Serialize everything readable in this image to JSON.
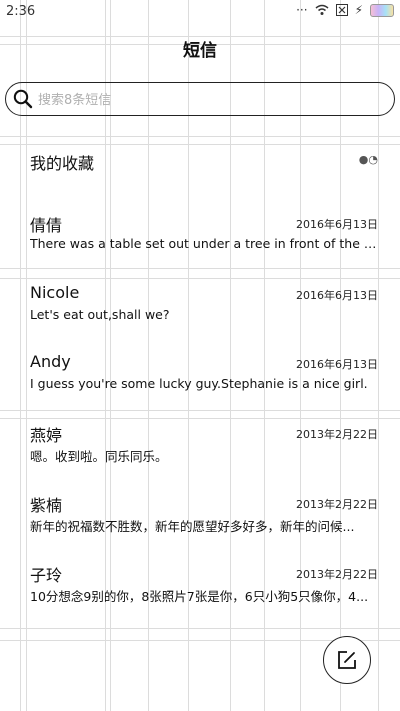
{
  "status_bar": {
    "time": "2:36",
    "icons": [
      "signal-dots-icon",
      "wifi-icon",
      "close-box-icon",
      "charging-bolt-icon",
      "battery-icon"
    ]
  },
  "header": {
    "title": "短信"
  },
  "search": {
    "placeholder": "搜索8条短信",
    "value": ""
  },
  "favorites": {
    "label": "我的收藏"
  },
  "conversations": [
    {
      "name": "倩倩",
      "date": "2016年6月13日",
      "preview": "There was a table set out under a tree in front of the ho..."
    },
    {
      "name": "Nicole",
      "date": "2016年6月13日",
      "preview": "Let's eat out,shall we?"
    },
    {
      "name": "Andy",
      "date": "2016年6月13日",
      "preview": "I guess you're some lucky guy.Stephanie is a nice girl."
    },
    {
      "name": "燕婷",
      "date": "2013年2月22日",
      "preview": "嗯。收到啦。同乐同乐。"
    },
    {
      "name": "紫楠",
      "date": "2013年2月22日",
      "preview": "新年的祝福数不胜数，新年的愿望好多好多，新年的问候..."
    },
    {
      "name": "子玲",
      "date": "2013年2月22日",
      "preview": "10分想念9别的你，8张照片7张是你，6只小狗5只像你，4..."
    }
  ],
  "compose": {
    "icon": "compose-icon"
  },
  "colors": {
    "border": "#222222",
    "placeholder": "#b0b0b0",
    "grid_line": "#dcdcdc"
  }
}
